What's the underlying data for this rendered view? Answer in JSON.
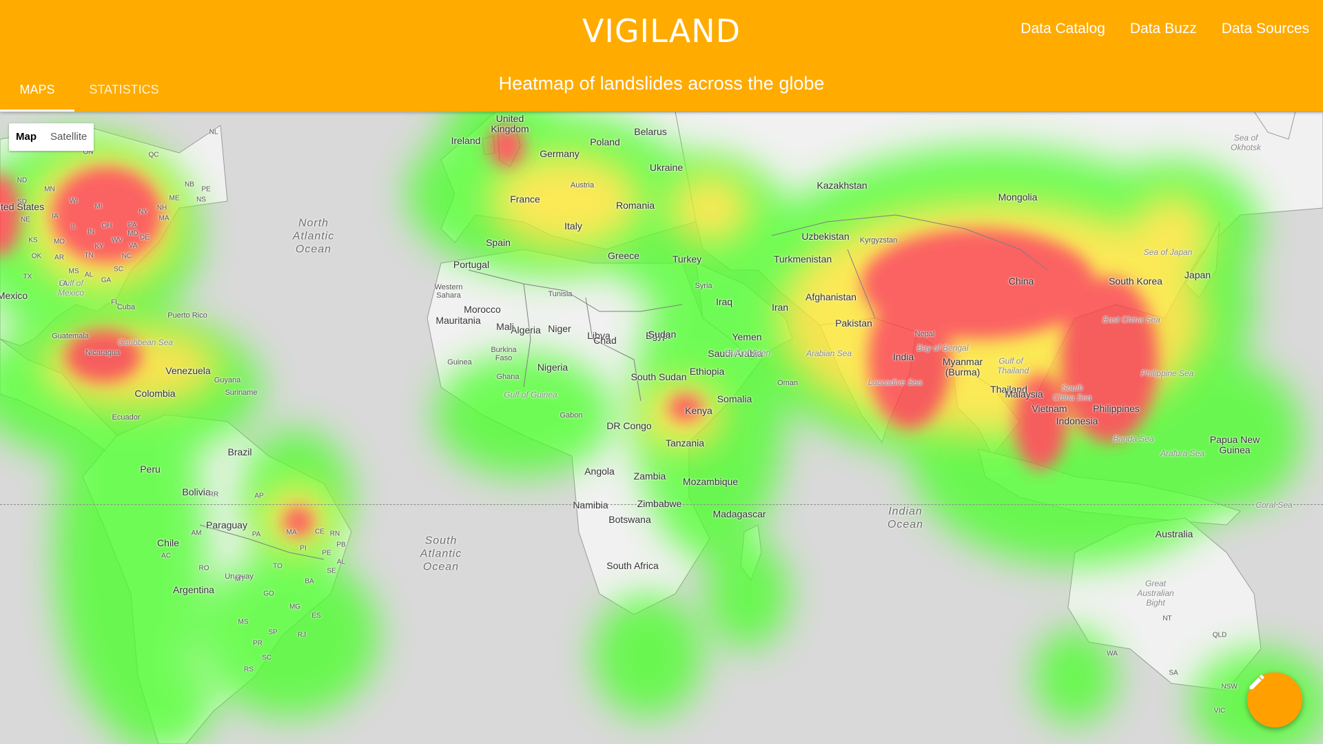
{
  "header": {
    "title": "VIGILAND",
    "subtitle": "Heatmap of landslides across the globe",
    "nav": [
      "Data Catalog",
      "Data Buzz",
      "Data Sources"
    ],
    "tabs": [
      "MAPS",
      "STATISTICS"
    ],
    "active_tab": "MAPS",
    "color": "#ffab00"
  },
  "map": {
    "type_control": {
      "map_label": "Map",
      "satellite_label": "Satellite",
      "selected": "Map"
    },
    "heat_colors": [
      "#00ff00",
      "#ffff00",
      "#ff0000"
    ]
  },
  "map_labels": {
    "united_kingdom": "United Kingdom",
    "ireland": "Ireland",
    "poland": "Poland",
    "belarus": "Belarus",
    "germany": "Germany",
    "ukraine": "Ukraine",
    "austria": "Austria",
    "france": "France",
    "romania": "Romania",
    "italy": "Italy",
    "kazakhstan": "Kazakhstan",
    "mongolia": "Mongolia",
    "uzbekistan": "Uzbekistan",
    "kyrgyzstan": "Kyrgyzstan",
    "turkmenistan": "Turkmenistan",
    "spain": "Spain",
    "portugal": "Portugal",
    "greece": "Greece",
    "turkey": "Turkey",
    "syria": "Syria",
    "iraq": "Iraq",
    "iran": "Iran",
    "afghanistan": "Afghanistan",
    "pakistan": "Pakistan",
    "china": "China",
    "nepal": "Nepal",
    "south_korea": "South Korea",
    "japan": "Japan",
    "sea_of_japan": "Sea of Japan",
    "sea_of_okhotsk": "Sea of Okhotsk",
    "east_china_sea": "East China Sea",
    "morocco": "Morocco",
    "tunisia": "Tunisia",
    "algeria": "Algeria",
    "libya": "Libya",
    "egypt": "Egypt",
    "saudi_arabia": "Saudi Arabia",
    "oman": "Oman",
    "india": "India",
    "myanmar": "Myanmar (Burma)",
    "thailand": "Thailand",
    "vietnam": "Vietnam",
    "philippines": "Philippines",
    "philippine_sea": "Philippine Sea",
    "south_china_sea": "South China Sea",
    "western_sahara": "Western Sahara",
    "mauritania": "Mauritania",
    "mali": "Mali",
    "niger": "Niger",
    "chad": "Chad",
    "sudan": "Sudan",
    "yemen": "Yemen",
    "gulf_of_aden": "Gulf of Aden",
    "arabian_sea": "Arabian Sea",
    "bay_of_bengal": "Bay of Bengal",
    "laccadive_sea": "Laccadive Sea",
    "gulf_of_thailand": "Gulf of Thailand",
    "burkina_faso": "Burkina Faso",
    "guinea": "Guinea",
    "ghana": "Ghana",
    "nigeria": "Nigeria",
    "south_sudan": "South Sudan",
    "ethiopia": "Ethiopia",
    "somalia": "Somalia",
    "gulf_of_guinea": "Gulf of Guinea",
    "malaysia": "Malaysia",
    "indonesia": "Indonesia",
    "kenya": "Kenya",
    "gabon": "Gabon",
    "dr_congo": "DR Congo",
    "tanzania": "Tanzania",
    "papua_new_guinea": "Papua New Guinea",
    "banda_sea": "Banda Sea",
    "arafura_sea": "Arafura Sea",
    "angola": "Angola",
    "zambia": "Zambia",
    "mozambique": "Mozambique",
    "namibia": "Namibia",
    "zimbabwe": "Zimbabwe",
    "botswana": "Botswana",
    "madagascar": "Madagascar",
    "south_africa": "South Africa",
    "indian_ocean": "Indian Ocean",
    "australia": "Australia",
    "coral_sea": "Coral Sea",
    "great_australian_bight": "Great Australian Bight",
    "north_atlantic_ocean": "North Atlantic Ocean",
    "south_atlantic_ocean": "South Atlantic Ocean",
    "united_states": "ited States",
    "mexico": "Mexico",
    "gulf_of_mexico": "Gulf of Mexico",
    "cuba": "Cuba",
    "puerto_rico": "Puerto Rico",
    "guatemala": "Guatemala",
    "nicaragua": "Nicaragua",
    "caribbean_sea": "Caribbean Sea",
    "venezuela": "Venezuela",
    "guyana": "Guyana",
    "suriname": "Suriname",
    "colombia": "Colombia",
    "ecuador": "Ecuador",
    "peru": "Peru",
    "brazil": "Brazil",
    "bolivia": "Bolivia",
    "paraguay": "Paraguay",
    "chile": "Chile",
    "uruguay": "Uruguay",
    "argentina": "Argentina",
    "state_abbrs": [
      [
        "NL",
        310,
        30
      ],
      [
        "ON",
        128,
        59
      ],
      [
        "QC",
        223,
        63
      ],
      [
        "ND",
        32,
        100
      ],
      [
        "MN",
        72,
        113
      ],
      [
        "NB",
        275,
        106
      ],
      [
        "PE",
        299,
        113
      ],
      [
        "NS",
        292,
        128
      ],
      [
        "SD",
        32,
        131
      ],
      [
        "WI",
        107,
        130
      ],
      [
        "ME",
        253,
        126
      ],
      [
        "MI",
        143,
        138
      ],
      [
        "NY",
        208,
        146
      ],
      [
        "NH",
        235,
        140
      ],
      [
        "MA",
        238,
        155
      ],
      [
        "NE",
        37,
        157
      ],
      [
        "IA",
        80,
        152
      ],
      [
        "IL",
        107,
        167
      ],
      [
        "IN",
        132,
        175
      ],
      [
        "OH",
        155,
        166
      ],
      [
        "PA",
        192,
        165
      ],
      [
        "MD",
        193,
        177
      ],
      [
        "DE",
        210,
        183
      ],
      [
        "KS",
        48,
        187
      ],
      [
        "MO",
        86,
        189
      ],
      [
        "WV",
        170,
        187
      ],
      [
        "KY",
        144,
        196
      ],
      [
        "VA",
        193,
        195
      ],
      [
        "OK",
        53,
        210
      ],
      [
        "AR",
        86,
        212
      ],
      [
        "TN",
        129,
        209
      ],
      [
        "NC",
        184,
        210
      ],
      [
        "MS",
        107,
        232
      ],
      [
        "AL",
        129,
        237
      ],
      [
        "SC",
        172,
        229
      ],
      [
        "GA",
        154,
        245
      ],
      [
        "TX",
        40,
        240
      ],
      [
        "LA",
        92,
        250
      ],
      [
        "FL",
        167,
        277
      ],
      [
        "RR",
        310,
        556
      ],
      [
        "AP",
        376,
        558
      ],
      [
        "AM",
        285,
        612
      ],
      [
        "PA",
        372,
        614
      ],
      [
        "MA",
        423,
        611
      ],
      [
        "CE",
        464,
        610
      ],
      [
        "RN",
        486,
        613
      ],
      [
        "PB",
        495,
        629
      ],
      [
        "PI",
        440,
        634
      ],
      [
        "PE",
        474,
        641
      ],
      [
        "AL",
        495,
        654
      ],
      [
        "AC",
        241,
        645
      ],
      [
        "RO",
        296,
        663
      ],
      [
        "TO",
        403,
        660
      ],
      [
        "SE",
        481,
        667
      ],
      [
        "MT",
        348,
        679
      ],
      [
        "BA",
        449,
        682
      ],
      [
        "GO",
        390,
        700
      ],
      [
        "MG",
        428,
        719
      ],
      [
        "ES",
        459,
        732
      ],
      [
        "MS",
        353,
        741
      ],
      [
        "SP",
        396,
        756
      ],
      [
        "RJ",
        438,
        760
      ],
      [
        "PR",
        374,
        772
      ],
      [
        "SC",
        387,
        793
      ],
      [
        "RS",
        361,
        810
      ],
      [
        "NT",
        1694,
        736
      ],
      [
        "QLD",
        1770,
        760
      ],
      [
        "WA",
        1614,
        787
      ],
      [
        "SA",
        1703,
        815
      ],
      [
        "NSW",
        1784,
        835
      ],
      [
        "VIC",
        1770,
        870
      ]
    ]
  },
  "fab": {
    "icon": "pencil-icon"
  }
}
